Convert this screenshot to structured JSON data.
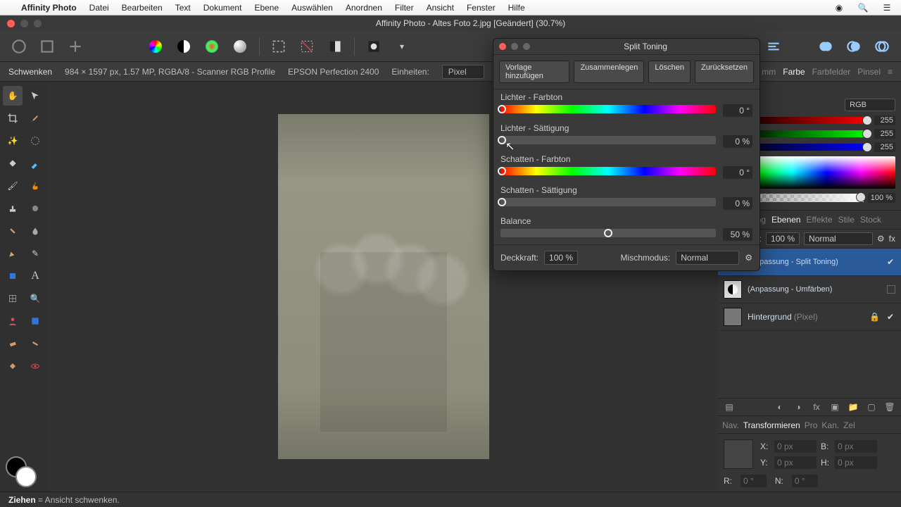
{
  "mac_menu": {
    "app": "Affinity Photo",
    "items": [
      "Datei",
      "Bearbeiten",
      "Text",
      "Dokument",
      "Ebene",
      "Auswählen",
      "Anordnen",
      "Filter",
      "Ansicht",
      "Fenster",
      "Hilfe"
    ]
  },
  "window_title": "Affinity Photo - Altes Foto 2.jpg [Geändert] (30.7%)",
  "context": {
    "tool": "Schwenken",
    "info": "984 × 1597 px, 1.57 MP, RGBA/8 - Scanner RGB Profile",
    "scanner": "EPSON Perfection 2400",
    "units_label": "Einheiten:",
    "units_value": "Pixel",
    "tabs_right": [
      "mm",
      "Farbe",
      "Farbfelder",
      "Pinsel"
    ],
    "tabs_active": "Farbe"
  },
  "color_panel": {
    "mode": "RGB",
    "r": "255",
    "g": "255",
    "b": "255",
    "opacity": "100 %"
  },
  "layers_tabs": [
    "Anpassung",
    "Ebenen",
    "Effekte",
    "Stile",
    "Stock"
  ],
  "layers_active": "Ebenen",
  "layers_opacity_label": "Deckkraft:",
  "layers_opacity_value": "100 %",
  "layers_blend": "Normal",
  "layers": [
    {
      "name": "(Anpassung - Split Toning)",
      "type": "adj",
      "selected": true,
      "checked": true
    },
    {
      "name": "(Anpassung - Umfärben)",
      "type": "adj",
      "selected": false,
      "checked": false
    },
    {
      "name": "Hintergrund",
      "suffix": "(Pixel)",
      "type": "px",
      "selected": false,
      "checked": true,
      "locked": true
    }
  ],
  "nav_tabs": [
    "Nav.",
    "Transformieren",
    "Pro",
    "Kan.",
    "Zel"
  ],
  "nav_active": "Transformieren",
  "transform": {
    "x": "0 px",
    "y": "0 px",
    "b": "0 px",
    "h": "0 px",
    "r": "0 °",
    "n": "0 °"
  },
  "status": {
    "bold": "Ziehen",
    "rest": " = Ansicht schwenken."
  },
  "panel": {
    "title": "Split Toning",
    "buttons": [
      "Vorlage hinzufügen",
      "Zusammenlegen",
      "Löschen",
      "Zurücksetzen"
    ],
    "sections": {
      "highlight_hue": {
        "label": "Lichter - Farbton",
        "value": "0 °"
      },
      "highlight_sat": {
        "label": "Lichter - Sättigung",
        "value": "0 %"
      },
      "shadow_hue": {
        "label": "Schatten - Farbton",
        "value": "0 °"
      },
      "shadow_sat": {
        "label": "Schatten - Sättigung",
        "value": "0 %"
      },
      "balance": {
        "label": "Balance",
        "value": "50 %"
      }
    },
    "opacity_label": "Deckkraft:",
    "opacity_value": "100 %",
    "blend_label": "Mischmodus:",
    "blend_value": "Normal"
  }
}
